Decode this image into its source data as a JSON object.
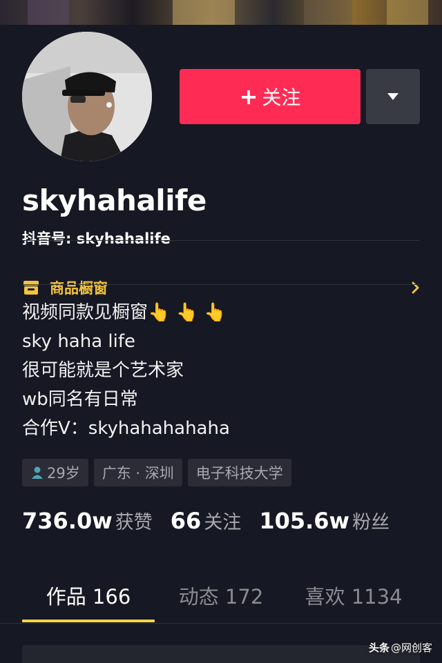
{
  "header": {
    "follow_label": "关注",
    "follow_plus": "+",
    "more_icon": "caret-down-icon"
  },
  "profile": {
    "username": "skyhahalife",
    "douyin_id": "抖音号: skyhahalife",
    "shop_label": "商品橱窗",
    "bio_lines": [
      "视频同款见橱窗",
      "sky haha life",
      "很可能就是个艺术家",
      "wb同名有日常",
      "合作V：skyhahahahaha"
    ],
    "bio_emoji": "👆 👆 👆",
    "tags": [
      "29岁",
      "广东 · 深圳",
      "电子科技大学"
    ]
  },
  "stats": [
    {
      "value": "736.0w",
      "label": "获赞"
    },
    {
      "value": "66",
      "label": "关注"
    },
    {
      "value": "105.6w",
      "label": "粉丝"
    }
  ],
  "tabs": [
    {
      "label": "作品 166",
      "active": true
    },
    {
      "label": "动态 172",
      "active": false
    },
    {
      "label": "喜欢 1134",
      "active": false
    }
  ],
  "watermark": {
    "brand": "头条",
    "handle": "@网创客"
  },
  "colors": {
    "background": "#161823",
    "follow": "#fe2c55",
    "shop": "#f3c33c",
    "tab_underline": "#fbd64a",
    "tag_bg": "#2b2c36"
  }
}
